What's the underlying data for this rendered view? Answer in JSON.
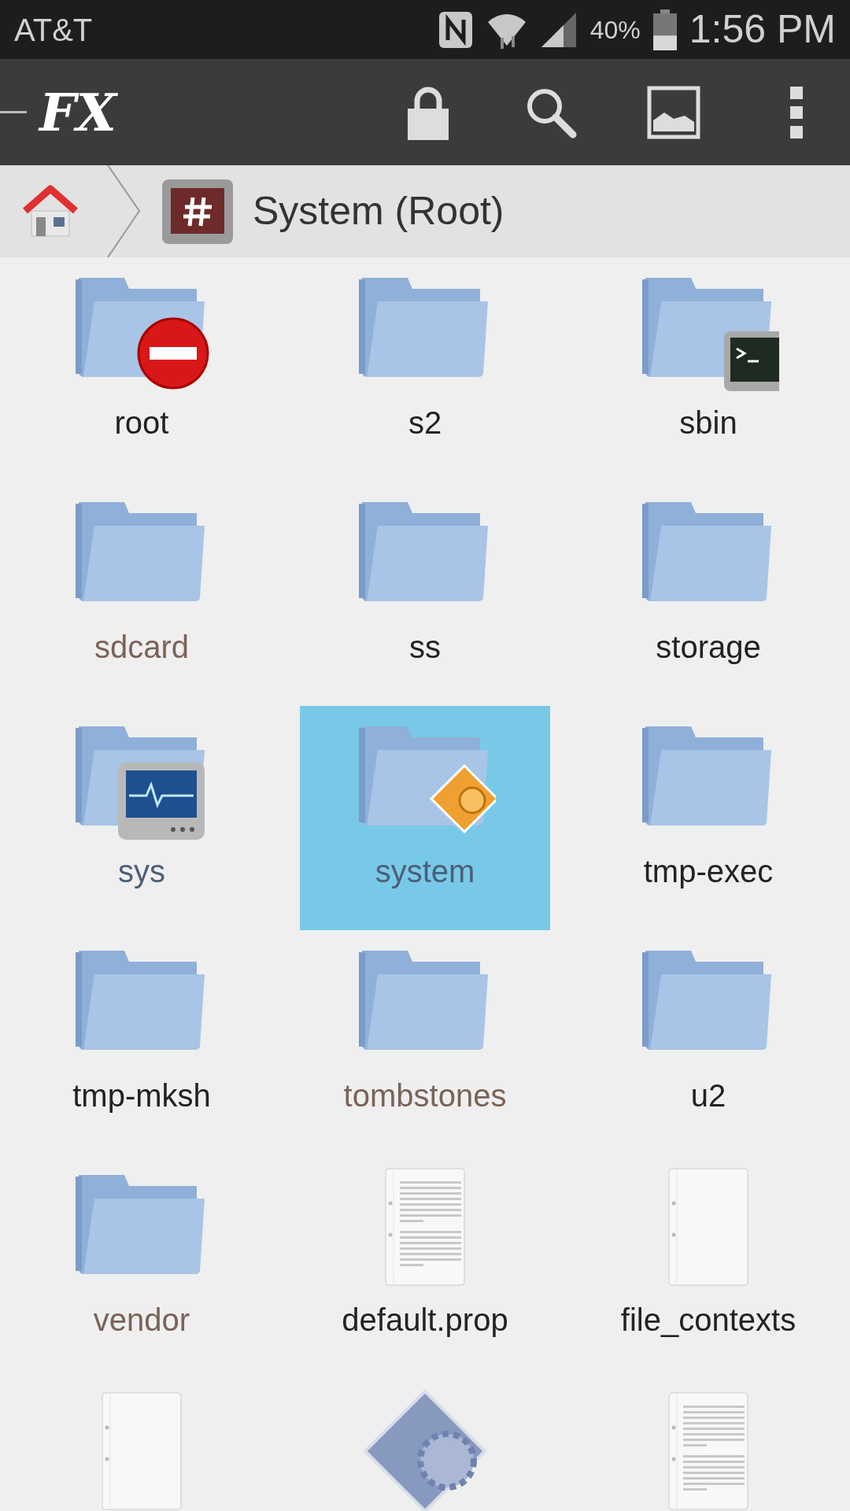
{
  "status_bar": {
    "carrier": "AT&T",
    "battery_text": "40%",
    "time": "1:56 PM"
  },
  "toolbar": {
    "logo": "FX"
  },
  "breadcrumb": {
    "title": "System (Root)"
  },
  "items": [
    {
      "name": "root",
      "kind": "folder",
      "badge": {
        "kind": "blocked"
      },
      "color": "#222222",
      "selected": false
    },
    {
      "name": "s2",
      "kind": "folder",
      "color": "#222222",
      "selected": false
    },
    {
      "name": "sbin",
      "kind": "folder",
      "badge": {
        "kind": "terminal"
      },
      "color": "#222222",
      "selected": false
    },
    {
      "name": "sdcard",
      "kind": "folder",
      "color": "#7a6358",
      "selected": false
    },
    {
      "name": "ss",
      "kind": "folder",
      "color": "#222222",
      "selected": false
    },
    {
      "name": "storage",
      "kind": "folder",
      "color": "#222222",
      "selected": false
    },
    {
      "name": "sys",
      "kind": "folder",
      "badge": {
        "kind": "monitor"
      },
      "color": "#4d5e78",
      "selected": false
    },
    {
      "name": "system",
      "kind": "folder",
      "badge": {
        "kind": "settings"
      },
      "color": "#4d5e78",
      "selected": true
    },
    {
      "name": "tmp-exec",
      "kind": "folder",
      "color": "#222222",
      "selected": false
    },
    {
      "name": "tmp-mksh",
      "kind": "folder",
      "color": "#222222",
      "selected": false
    },
    {
      "name": "tombstones",
      "kind": "folder",
      "color": "#7a6358",
      "selected": false
    },
    {
      "name": "u2",
      "kind": "folder",
      "color": "#222222",
      "selected": false
    },
    {
      "name": "vendor",
      "kind": "folder",
      "color": "#7a6358",
      "selected": false
    },
    {
      "name": "default.prop",
      "kind": "text",
      "color": "#222222",
      "selected": false
    },
    {
      "name": "file_contexts",
      "kind": "blank",
      "color": "#222222",
      "selected": false
    },
    {
      "kind": "blank",
      "selected": false
    },
    {
      "kind": "gear",
      "selected": false
    },
    {
      "kind": "text",
      "selected": false
    }
  ]
}
